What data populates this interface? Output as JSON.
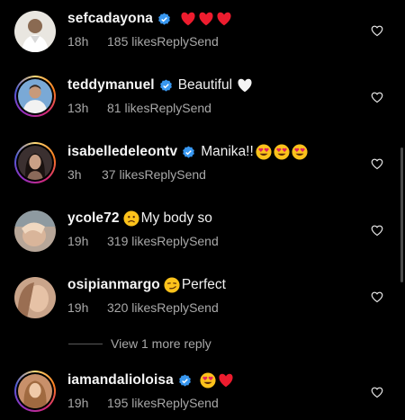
{
  "comments": [
    {
      "username": "sefcadayona",
      "verified": true,
      "text": "",
      "emojis": [
        "heart",
        "heart",
        "heart"
      ],
      "time": "18h",
      "likes": "185 likes",
      "reply": "Reply",
      "send": "Send"
    },
    {
      "username": "teddymanuel",
      "verified": true,
      "text": "Beautiful",
      "emojis_after": [
        "white-heart"
      ],
      "time": "13h",
      "likes": "81 likes",
      "reply": "Reply",
      "send": "Send"
    },
    {
      "username": "isabelledeleontv",
      "verified": true,
      "text": "Manika!!",
      "emojis_after": [
        "heart-eyes",
        "heart-eyes",
        "heart-eyes"
      ],
      "time": "3h",
      "likes": "37 likes",
      "reply": "Reply",
      "send": "Send"
    },
    {
      "username": "ycole72",
      "verified": false,
      "text": "My body so",
      "emojis_before": [
        "frowning-face"
      ],
      "time": "19h",
      "likes": "319 likes",
      "reply": "Reply",
      "send": "Send"
    },
    {
      "username": "osipianmargo",
      "verified": false,
      "text": "Perfect",
      "emojis_before": [
        "smirk-face"
      ],
      "time": "19h",
      "likes": "320 likes",
      "reply": "Reply",
      "send": "Send"
    },
    {
      "username": "iamandalioloisa",
      "verified": true,
      "text": "",
      "emojis": [
        "heart-eyes",
        "heart"
      ],
      "time": "19h",
      "likes": "195 likes",
      "reply": "Reply",
      "send": "Send"
    }
  ],
  "view_more": "View 1 more reply",
  "colors": {
    "background": "#000000",
    "meta": "#a8a8a8",
    "verified": "#3897f0",
    "heart_red": "#ed1c2e"
  }
}
